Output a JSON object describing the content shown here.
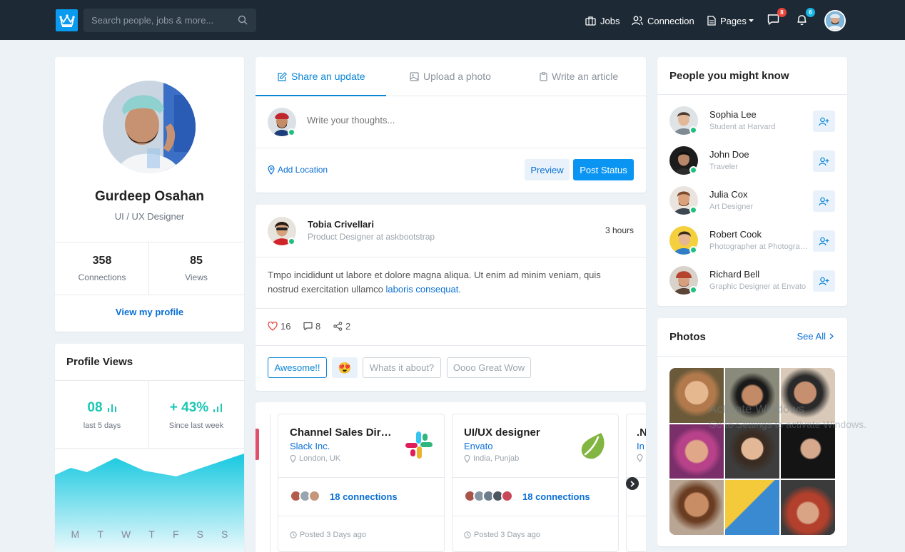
{
  "search": {
    "placeholder": "Search people, jobs & more..."
  },
  "nav": {
    "jobs": "Jobs",
    "connection": "Connection",
    "pages": "Pages",
    "messages_count": "8",
    "notifications_count": "6"
  },
  "profile": {
    "name": "Gurdeep Osahan",
    "role": "UI / UX Designer",
    "connections_value": "358",
    "connections_label": "Connections",
    "views_value": "85",
    "views_label": "Views",
    "view_link": "View my profile"
  },
  "profile_views": {
    "title": "Profile Views",
    "stat1_value": "08",
    "stat1_label": "last 5 days",
    "stat2_value": "+ 43%",
    "stat2_label": "Since last week",
    "days": [
      "M",
      "T",
      "W",
      "T",
      "F",
      "S",
      "S"
    ]
  },
  "composer": {
    "tab1": "Share an update",
    "tab2": "Upload a photo",
    "tab3": "Write an article",
    "placeholder": "Write your thoughts...",
    "add_location": "Add Location",
    "preview": "Preview",
    "post_status": "Post Status"
  },
  "post": {
    "author": "Tobia Crivellari",
    "subtitle": "Product Designer at askbootstrap",
    "time": "3 hours",
    "text_main": "Tmpo incididunt ut labore et dolore magna aliqua. Ut enim ad minim veniam, quis nostrud exercitation ullamco ",
    "text_link": "laboris consequat.",
    "likes": "16",
    "comments": "8",
    "shares": "2",
    "chip1": "Awesome!!",
    "chip2": "😍",
    "chip3": "Whats it about?",
    "chip4": "Oooo Great Wow"
  },
  "jobs": [
    {
      "title": "Channel Sales Director",
      "company": "Slack Inc.",
      "location": "London, UK",
      "connections": "18 connections",
      "posted": "Posted 3 Days ago"
    },
    {
      "title": "UI/UX designer",
      "company": "Envato",
      "location": "India, Punjab",
      "connections": "18 connections",
      "posted": "Posted 3 Days ago"
    },
    {
      "title": ".N",
      "company": "In",
      "location": ""
    }
  ],
  "people": {
    "title": "People you might know",
    "list": [
      {
        "name": "Sophia Lee",
        "role": "Student at Harvard"
      },
      {
        "name": "John Doe",
        "role": "Traveler"
      },
      {
        "name": "Julia Cox",
        "role": "Art Designer"
      },
      {
        "name": "Robert Cook",
        "role": "Photographer at Photography"
      },
      {
        "name": "Richard Bell",
        "role": "Graphic Designer at Envato"
      }
    ]
  },
  "photos": {
    "title": "Photos",
    "see_all": "See All"
  },
  "watermark": {
    "line1": "Activate Windows",
    "line2": "Go to Settings to activate Windows."
  },
  "colors": {
    "accent": "#0a85d6",
    "nav_bg": "#1d2a35",
    "online": "#1ec07e",
    "chart_teal": "#1dc7b4"
  }
}
